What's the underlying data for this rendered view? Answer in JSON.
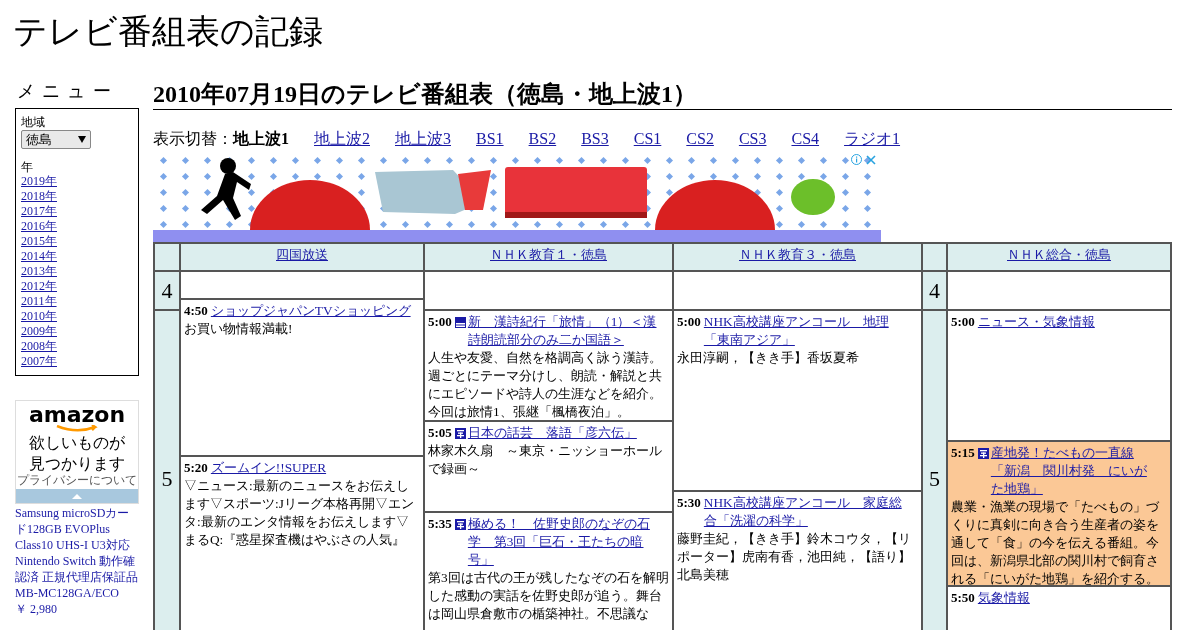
{
  "site_title": "テレビ番組表の記録",
  "sidebar": {
    "menu_heading": "メニュー",
    "region_label": "地域",
    "region": "徳島",
    "year_label": "年",
    "years": [
      "2019年",
      "2018年",
      "2017年",
      "2016年",
      "2015年",
      "2014年",
      "2013年",
      "2012年",
      "2011年",
      "2010年",
      "2009年",
      "2008年",
      "2007年"
    ]
  },
  "ad": {
    "logo": "amazon",
    "tagline": "欲しいものが見つかります",
    "privacy": "プライバシーについて",
    "product": "Samsung microSDカード128GB EVOPlus Class10 UHS-I U3対応 Nintendo Switch 動作確認済 正規代理店保証品 MB-MC128GA/ECO",
    "price": "￥ 2,980"
  },
  "page_heading": "2010年07月19日のテレビ番組表（徳島・地上波1）",
  "switcher": {
    "label": "表示切替：",
    "tabs": [
      {
        "label": "地上波1",
        "selected": true
      },
      {
        "label": "地上波2",
        "selected": false
      },
      {
        "label": "地上波3",
        "selected": false
      },
      {
        "label": "BS1",
        "selected": false
      },
      {
        "label": "BS2",
        "selected": false
      },
      {
        "label": "BS3",
        "selected": false
      },
      {
        "label": "CS1",
        "selected": false
      },
      {
        "label": "CS2",
        "selected": false
      },
      {
        "label": "CS3",
        "selected": false
      },
      {
        "label": "CS4",
        "selected": false
      },
      {
        "label": "ラジオ1",
        "selected": false
      }
    ]
  },
  "schedule": {
    "columns": [
      {
        "kind": "hours",
        "hours": [
          "4",
          "5"
        ]
      },
      {
        "kind": "channel",
        "name": "四国放送",
        "programs": [
          {
            "time": "4:50",
            "kind": "plain",
            "title": "ショップジャパンTVショッピング",
            "description": "お買い物情報満載!",
            "highlighted": false
          },
          {
            "time": "5:20",
            "kind": "plain",
            "title": "ズームイン!!SUPER",
            "description": "▽ニュース:最新のニュースをお伝えします▽スポーツ:Jリーグ本格再開▽エンタ:最新のエンタ情報をお伝えします▽まるQ:『惑星探査機はやぶさの人気』",
            "highlighted": false
          }
        ]
      },
      {
        "kind": "channel",
        "name": "ＮＨＫ教育１・徳島",
        "programs": [
          {
            "time": "5:00",
            "kind": "lines",
            "title": "新　漢詩紀行「旅情」（1）＜漢詩朗読部分のみ二か国語＞",
            "description": "人生や友愛、自然を格調高く詠う漢詩。週ごとにテーマ分けし、朗読・解説と共にエピソードや詩人の生涯などを紹介。今回は旅情1、張継「楓橋夜泊」。",
            "highlighted": false
          },
          {
            "time": "5:05",
            "kind": "square",
            "title": "日本の話芸　落語「彦六伝」",
            "description": "林家木久扇　～東京・ニッショーホールで録画～",
            "highlighted": false
          },
          {
            "time": "5:35",
            "kind": "square",
            "title": "極める！　佐野史郎のなぞの石学　第3回「巨石・王たちの暗号」",
            "description": "第3回は古代の王が残したなぞの石を解明した感動の実話を佐野史郎が追う。舞台は岡山県倉敷市の楯築神社。不思議な",
            "highlighted": false
          }
        ]
      },
      {
        "kind": "channel",
        "name": "ＮＨＫ教育３・徳島",
        "programs": [
          {
            "time": "5:00",
            "kind": "plain",
            "title": "NHK高校講座アンコール　地理「東南アジア」",
            "description": "永田淳嗣，【きき手】香坂夏希",
            "highlighted": false
          },
          {
            "time": "5:30",
            "kind": "plain",
            "title": "NHK高校講座アンコール　家庭総合「洗濯の科学」",
            "description": "藤野圭紀，【きき手】鈴木コウタ，【リポーター】虎南有香，池田純，【語り】北島美穂",
            "highlighted": false
          }
        ]
      },
      {
        "kind": "hours",
        "hours": [
          "4",
          "5"
        ]
      },
      {
        "kind": "channel",
        "name": "ＮＨＫ総合・徳島",
        "programs": [
          {
            "time": "5:00",
            "kind": "plain",
            "title": "ニュース・気象情報",
            "highlighted": false
          },
          {
            "time": "5:15",
            "kind": "square",
            "title": "産地発！たべもの一直線「新潟　関川村発　にいがた地鶏」",
            "description": "農業・漁業の現場で「たべもの」づくりに真剣に向き合う生産者の姿を通して「食」の今を伝える番組。今回は、新潟県北部の関川村で飼育される「にいがた地鶏」を紹介する。",
            "highlighted": true
          },
          {
            "time": "5:50",
            "kind": "plain",
            "title": "気象情報",
            "highlighted": false
          }
        ]
      }
    ]
  }
}
